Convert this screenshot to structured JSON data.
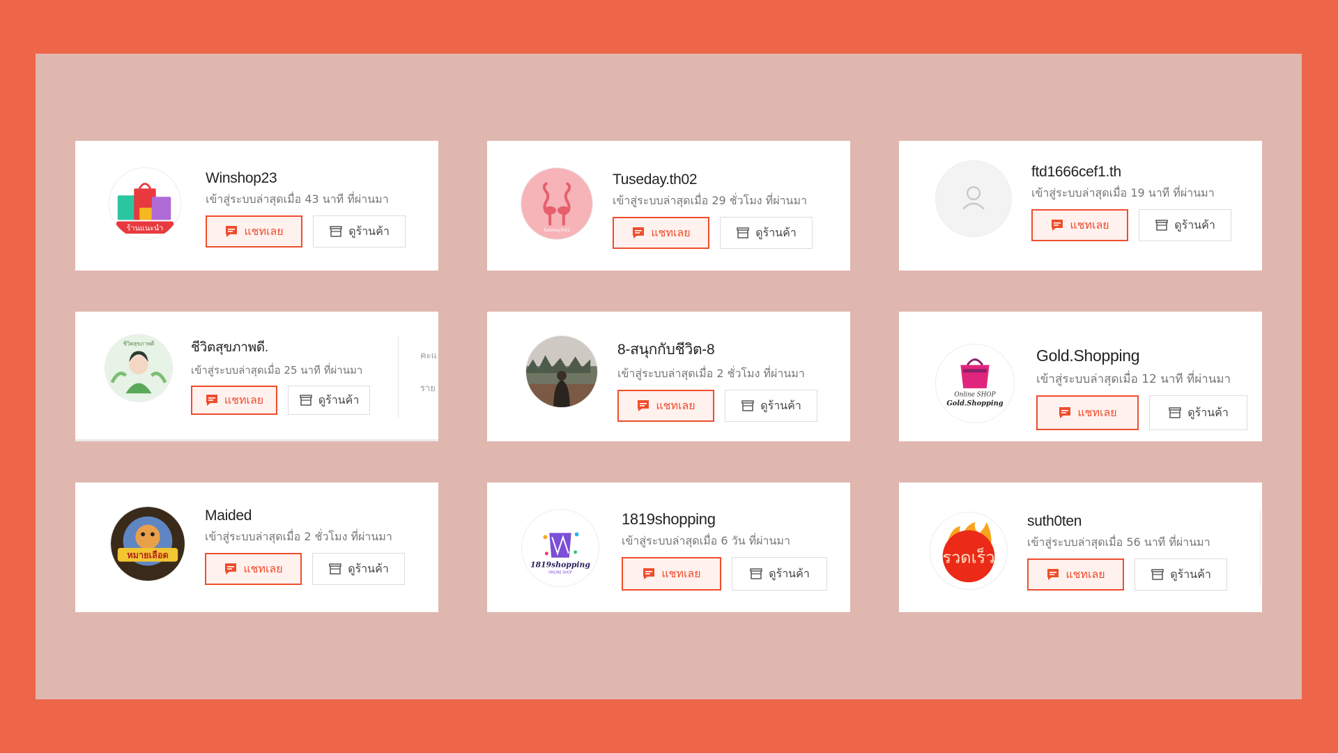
{
  "labels": {
    "chat": "แชทเลย",
    "view_shop": "ดูร้านค้า"
  },
  "colors": {
    "background": "#EE664A",
    "panel": "#DFB7AF",
    "accent": "#EE4D2D"
  },
  "cards": [
    {
      "name": "Winshop23",
      "last_seen": "เข้าสู่ระบบล่าสุดเมื่อ 43 นาที ที่ผ่านมา",
      "avatar_text": "ร้านแนะนำ",
      "avatar_icon": "shopping-bags-icon"
    },
    {
      "name": "Tuseday.th02",
      "last_seen": "เข้าสู่ระบบล่าสุดเมื่อ 29 ชั่วโมง ที่ผ่านมา",
      "avatar_text": "Tuseday.th02",
      "avatar_icon": "flamingo-icon"
    },
    {
      "name": "ftd1666cef1.th",
      "last_seen": "เข้าสู่ระบบล่าสุดเมื่อ 19 นาที ที่ผ่านมา",
      "avatar_icon": "default-user-icon"
    },
    {
      "name": "ชีวิตสุขภาพดี.",
      "last_seen": "เข้าสู่ระบบล่าสุดเมื่อ 25 นาที ที่ผ่านมา",
      "avatar_text": "ชีวิตสุขภาพดี",
      "avatar_icon": "woman-illustration-icon",
      "clipped_text_1": "คะแ",
      "clipped_text_2": "ราย"
    },
    {
      "name": "8-สนุกกับชีวิต-8",
      "last_seen": "เข้าสู่ระบบล่าสุดเมื่อ 2 ชั่วโมง ที่ผ่านมา",
      "avatar_icon": "landscape-photo-icon"
    },
    {
      "name": "Gold.Shopping",
      "last_seen": "เข้าสู่ระบบล่าสุดเมื่อ 12 นาที ที่ผ่านมา",
      "avatar_text": "Online SHOP",
      "avatar_text2": "Gold.Shopping",
      "avatar_icon": "shopping-bag-icon"
    },
    {
      "name": "Maided",
      "last_seen": "เข้าสู่ระบบล่าสุดเมื่อ 2 ชั่วโมง ที่ผ่านมา",
      "avatar_text": "หมายเลือด",
      "avatar_icon": "game-logo-icon"
    },
    {
      "name": "1819shopping",
      "last_seen": "เข้าสู่ระบบล่าสุดเมื่อ 6 วัน ที่ผ่านมา",
      "avatar_text": "1819shopping",
      "avatar_text2": "ONLINE SHOP",
      "avatar_icon": "shopping-bag-icon"
    },
    {
      "name": "suth0ten",
      "last_seen": "เข้าสู่ระบบล่าสุดเมื่อ 56 นาที ที่ผ่านมา",
      "avatar_text": "รวดเร็ว",
      "avatar_icon": "flame-icon"
    }
  ]
}
